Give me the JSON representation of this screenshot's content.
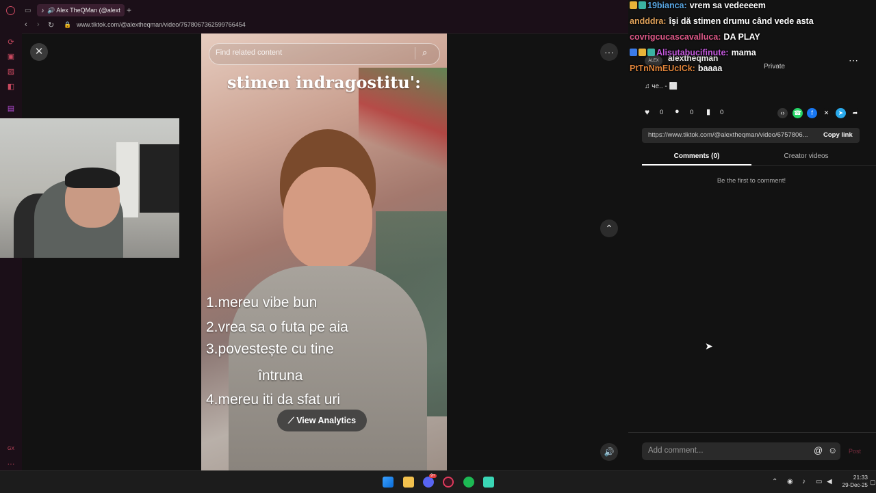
{
  "browser": {
    "tab_title": "Alex TheQMan (@alext",
    "new_tab": "+",
    "url": "www.tiktok.com/@alextheqman/video/7578067362599766454",
    "opera_sidebar_bottom_label": "GX",
    "opera_sidebar_more": "···"
  },
  "video": {
    "search_placeholder": "Find related content",
    "caption_title": "stimen indragostitu':",
    "list_items": [
      "1.mereu vibe bun",
      "2.vrea sa o futa pe aia",
      "3.povestește cu tine",
      "întruna",
      "4.mereu iti da sfat uri"
    ],
    "analytics_label": "View Analytics",
    "more_button": "···",
    "close_button": "✕"
  },
  "chat": [
    {
      "user": "19bianca:",
      "message": "vrem sa vedeeeem",
      "color": "#5aa9e6"
    },
    {
      "user": "andddra:",
      "message": "își dă stimen drumu când vede asta",
      "color": "#e0a25a"
    },
    {
      "user": "covrigcucascavalluca:",
      "message": "DA PLAY",
      "color": "#e05a8a"
    },
    {
      "user": "Alisutabucifinute:",
      "message": "mama",
      "color": "#c65ae0"
    },
    {
      "user": "PtTnNmEUcICk:",
      "message": "baaaa",
      "color": "#e0843a"
    }
  ],
  "post": {
    "account_name": "alextheqman",
    "avatar_label": "ALEX",
    "privacy": "Private",
    "music": "♫ че.. - ⬜",
    "likes": "0",
    "comments": "0",
    "saves": "0",
    "link": "https://www.tiktok.com/@alextheqman/video/6757806...",
    "copy_link": "Copy link"
  },
  "comments_panel": {
    "tab_comments": "Comments (0)",
    "tab_creator": "Creator videos",
    "empty_text": "Be the first to comment!",
    "input_placeholder": "Add comment...",
    "post_label": "Post"
  },
  "taskbar": {
    "time": "21:33",
    "date": "29-Dec-25",
    "discord_badge": "9+"
  },
  "colors": {
    "opera_accent": "#c8485f",
    "tiktok_bg": "#121212"
  }
}
